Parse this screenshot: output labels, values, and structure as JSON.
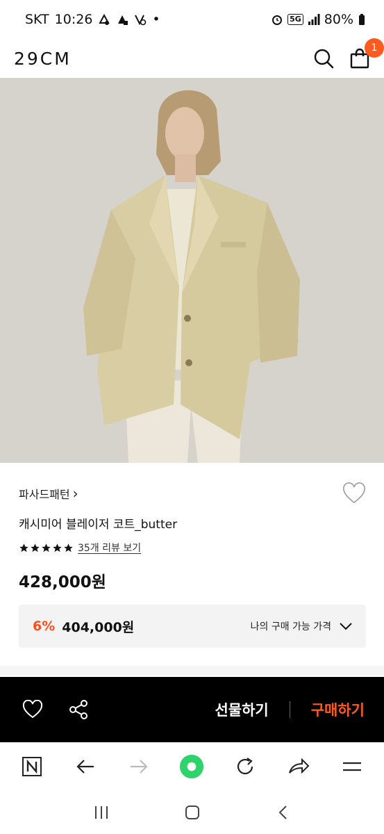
{
  "status_bar": {
    "carrier": "SKT",
    "time": "10:26",
    "dot": "•",
    "network": "5G",
    "battery": "80%"
  },
  "header": {
    "logo": "29CM",
    "cart_count": "1",
    "accent_color": "#ff5a1f"
  },
  "hero": {
    "icon": "product-photo"
  },
  "product": {
    "brand": "파사드패턴",
    "brand_chevron": "›",
    "name": "캐시미어 블레이저 코트_butter",
    "rating_stars": 5,
    "review_link": "35개 리뷰 보기",
    "price": "428,000원",
    "discount_rate": "6%",
    "sale_price": "404,000원",
    "my_price_label": "나의 구매 가능 가격"
  },
  "buy_bar": {
    "gift_label": "선물하기",
    "buy_label": "구매하기"
  },
  "browser": {
    "icons": [
      "n-icon",
      "back-arrow-icon",
      "forward-arrow-icon",
      "home-dot-icon",
      "refresh-icon",
      "share-icon",
      "menu-icon"
    ]
  },
  "nav": {
    "icons": [
      "recent-apps-icon",
      "home-icon",
      "back-icon"
    ]
  }
}
